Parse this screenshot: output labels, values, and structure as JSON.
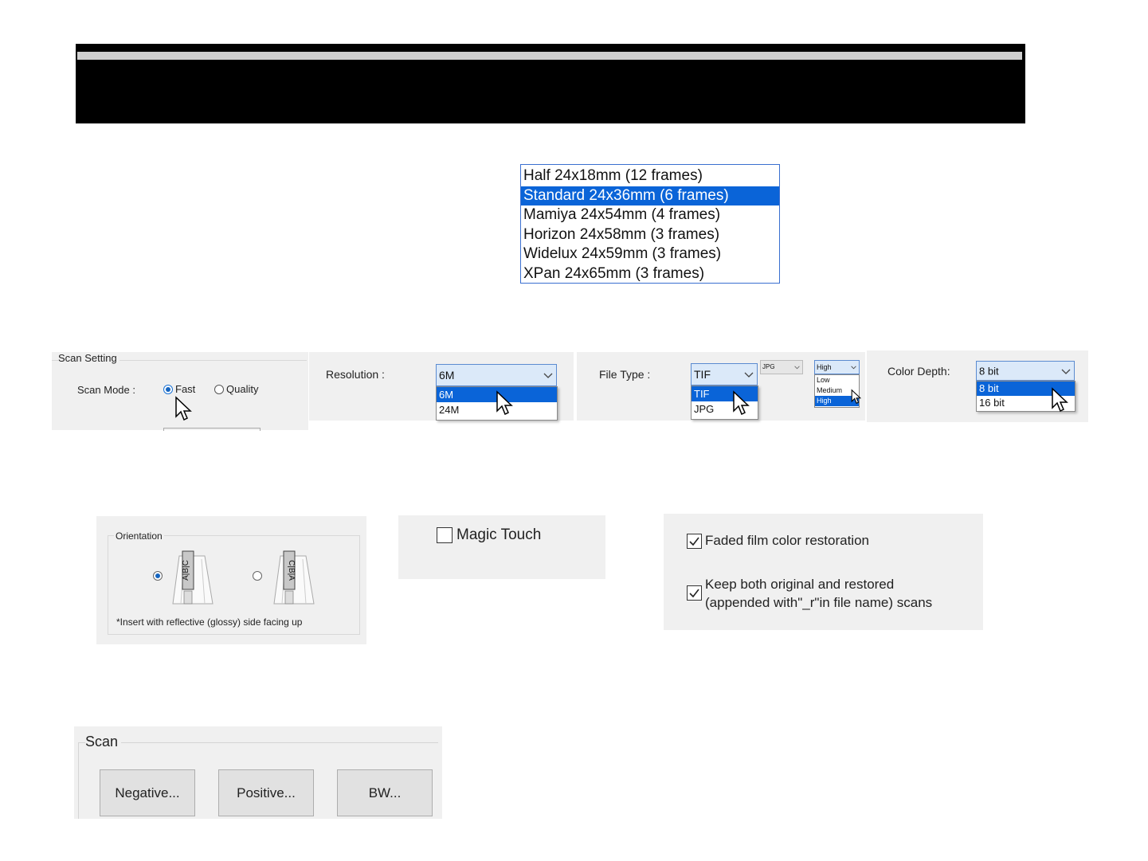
{
  "frame_list": {
    "options": [
      "Half 24x18mm (12 frames)",
      "Standard 24x36mm (6 frames)",
      "Mamiya 24x54mm (4 frames)",
      "Horizon 24x58mm (3 frames)",
      "Widelux 24x59mm (3 frames)",
      "XPan 24x65mm (3 frames)"
    ],
    "selected": "Standard 24x36mm (6 frames)"
  },
  "scan_setting": {
    "title": "Scan Setting",
    "scan_mode_label": "Scan Mode :",
    "fast_label": "Fast",
    "quality_label": "Quality",
    "selected": "Fast"
  },
  "resolution": {
    "label": "Resolution :",
    "value": "6M",
    "options": [
      "6M",
      "24M"
    ]
  },
  "file_type": {
    "label": "File Type :",
    "value": "TIF",
    "options": [
      "TIF",
      "JPG"
    ],
    "jpg_combo_value": "JPG",
    "quality_value": "High",
    "quality_options": [
      "Low",
      "Medium",
      "High"
    ]
  },
  "color_depth": {
    "label": "Color Depth:",
    "value": "8 bit",
    "options": [
      "8 bit",
      "16 bit"
    ]
  },
  "orientation": {
    "title": "Orientation",
    "option1_text": "A|B|C",
    "option2_text": "C|B|A",
    "note": "*Insert with reflective (glossy) side facing up"
  },
  "magic_touch": {
    "label": "Magic Touch",
    "checked": false
  },
  "restoration": {
    "faded_label": "Faded film color restoration",
    "keep_label_line1": "Keep both original and restored",
    "keep_label_line2": "(appended with\"_r\"in file name) scans",
    "faded_checked": true,
    "keep_checked": true
  },
  "scan": {
    "title": "Scan",
    "negative_label": "Negative...",
    "positive_label": "Positive...",
    "bw_label": "BW..."
  },
  "colors": {
    "selection": "#0a64d8",
    "panel": "#f0f0f0",
    "combo": "#dbe9f9"
  }
}
